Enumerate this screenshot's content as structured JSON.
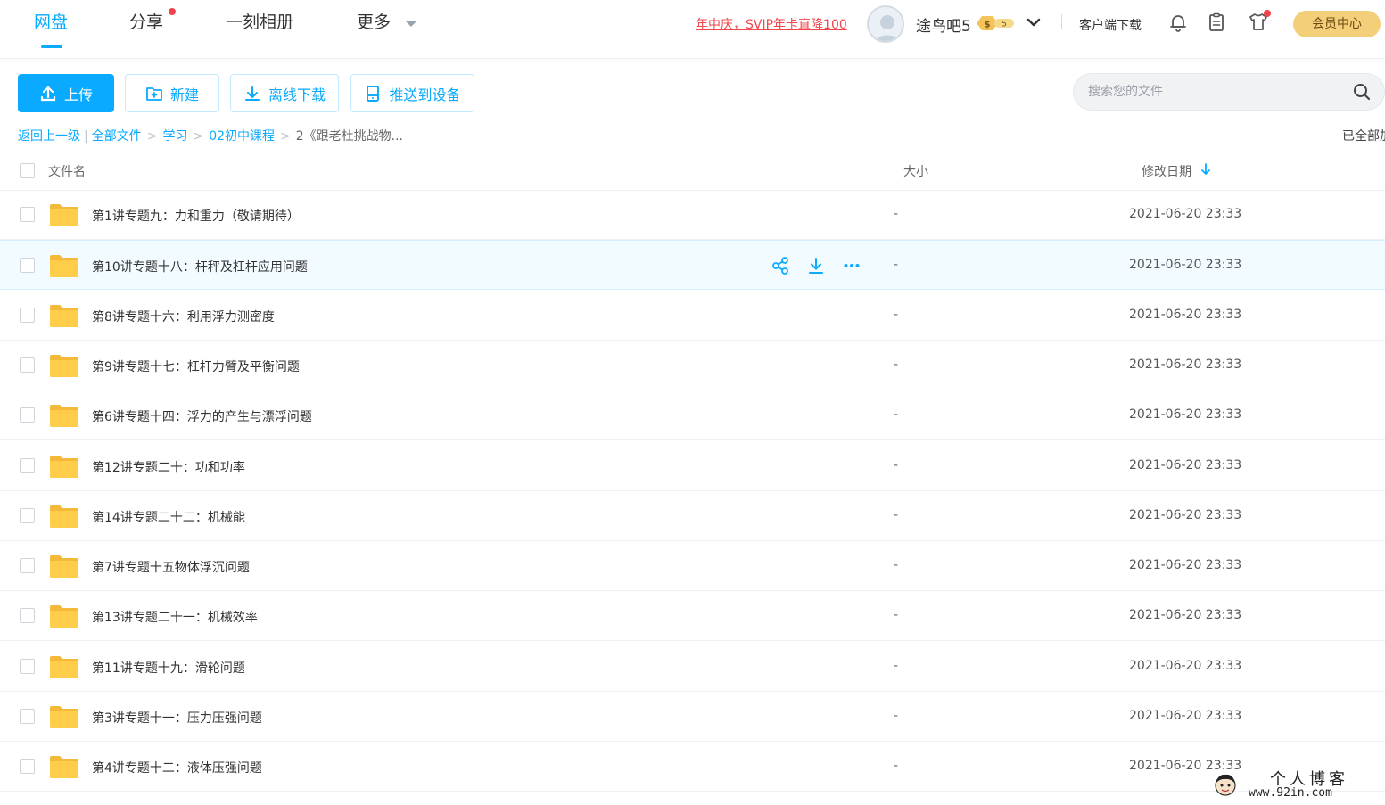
{
  "nav": {
    "tabs": [
      {
        "label": "网盘",
        "active": true
      },
      {
        "label": "分享",
        "has_dot": true
      },
      {
        "label": "一刻相册"
      },
      {
        "label": "更多"
      }
    ],
    "promo": "年中庆，SVIP年卡直降100",
    "username": "途鸟吧5",
    "badge_text": "5",
    "client_download": "客户端下载",
    "member_center": "会员中心",
    "icons": [
      "bell-icon",
      "clipboard-icon",
      "tshirt-icon"
    ]
  },
  "toolbar": {
    "upload": "上传",
    "new": "新建",
    "offline_download": "离线下载",
    "push_to_device": "推送到设备",
    "search_placeholder": "搜索您的文件"
  },
  "breadcrumb": {
    "back": "返回上一级",
    "items": [
      "全部文件",
      "学习",
      "02初中课程"
    ],
    "current": "2《跟老杜挑战物...",
    "loaded_status": "已全部加载"
  },
  "table": {
    "columns": {
      "name": "文件名",
      "size": "大小",
      "modified": "修改日期"
    },
    "sort": "modified-desc",
    "rows": [
      {
        "name": "第1讲专题九：力和重力（敬请期待）",
        "size": "-",
        "date": "2021-06-20 23:33"
      },
      {
        "name": "第10讲专题十八：杆秤及杠杆应用问题",
        "size": "-",
        "date": "2021-06-20 23:33",
        "hover": true
      },
      {
        "name": "第8讲专题十六：利用浮力测密度",
        "size": "-",
        "date": "2021-06-20 23:33"
      },
      {
        "name": "第9讲专题十七：杠杆力臂及平衡问题",
        "size": "-",
        "date": "2021-06-20 23:33"
      },
      {
        "name": "第6讲专题十四：浮力的产生与漂浮问题",
        "size": "-",
        "date": "2021-06-20 23:33"
      },
      {
        "name": "第12讲专题二十：功和功率",
        "size": "-",
        "date": "2021-06-20 23:33"
      },
      {
        "name": "第14讲专题二十二：机械能",
        "size": "-",
        "date": "2021-06-20 23:33"
      },
      {
        "name": "第7讲专题十五物体浮沉问题",
        "size": "-",
        "date": "2021-06-20 23:33"
      },
      {
        "name": "第13讲专题二十一：机械效率",
        "size": "-",
        "date": "2021-06-20 23:33"
      },
      {
        "name": "第11讲专题十九：滑轮问题",
        "size": "-",
        "date": "2021-06-20 23:33"
      },
      {
        "name": "第3讲专题十一：压力压强问题",
        "size": "-",
        "date": "2021-06-20 23:33"
      },
      {
        "name": "第4讲专题十二：液体压强问题",
        "size": "-",
        "date": "2021-06-20 23:33"
      }
    ]
  },
  "watermark": {
    "line1": "个人博客",
    "line2": "www.92in.com"
  },
  "colors": {
    "accent": "#09aaff",
    "promo": "#f0484d",
    "folder": "#ffcd4a",
    "member": "#f4cf7a"
  }
}
